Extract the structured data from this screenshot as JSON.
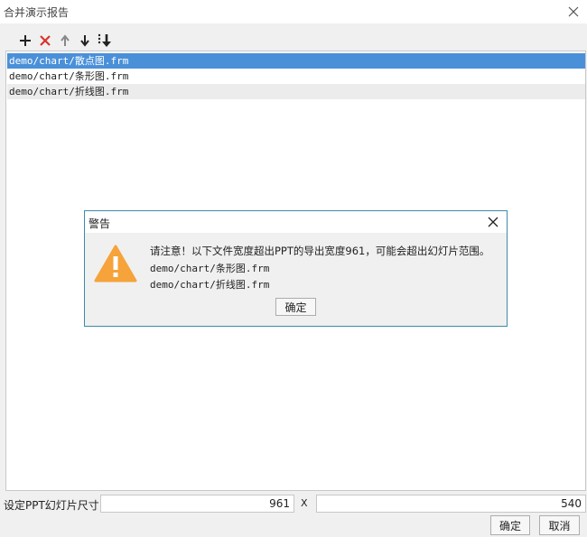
{
  "window": {
    "title": "合并演示报告"
  },
  "toolbar": {
    "buttons": [
      "add-icon",
      "delete-icon",
      "move-up-icon",
      "move-down-icon",
      "move-to-bottom-icon"
    ]
  },
  "files": [
    {
      "path": "demo/chart/散点图.frm",
      "selected": true
    },
    {
      "path": "demo/chart/条形图.frm",
      "selected": false
    },
    {
      "path": "demo/chart/折线图.frm",
      "selected": false
    }
  ],
  "warning_dialog": {
    "title": "警告",
    "message": "请注意！以下文件宽度超出PPT的导出宽度961，可能会超出幻灯片范围。",
    "files": [
      "demo/chart/条形图.frm",
      "demo/chart/折线图.frm"
    ],
    "ok_label": "确定",
    "colors": {
      "warning_icon": "#f5a33a",
      "border": "#3c8ca8"
    }
  },
  "slide_size": {
    "label": "设定PPT幻灯片尺寸",
    "width": "961",
    "separator": "X",
    "height": "540"
  },
  "footer": {
    "ok_label": "确定",
    "cancel_label": "取消"
  },
  "colors": {
    "selection": "#4a90d9",
    "delete_red": "#d9332b"
  }
}
